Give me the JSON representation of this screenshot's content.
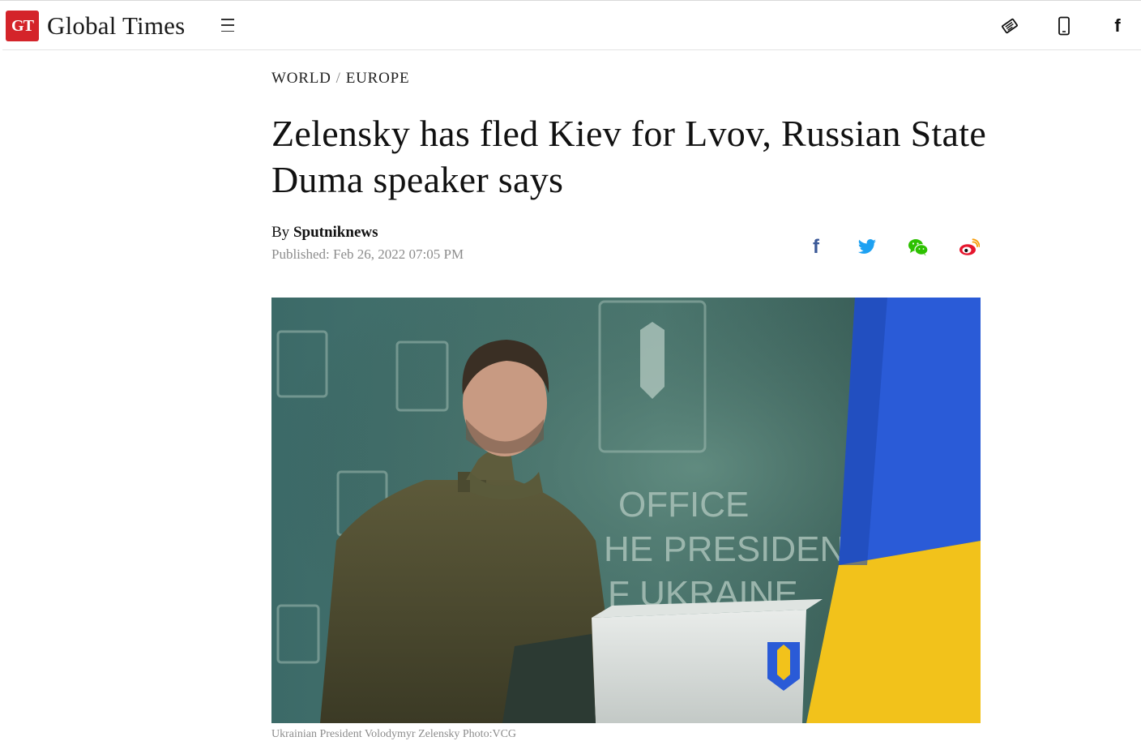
{
  "site": {
    "logo_badge": "GT",
    "name": "Global Times"
  },
  "header_icons": [
    "newspaper-icon",
    "mobile-phone-icon",
    "facebook-icon"
  ],
  "header_fb_glyph": "f",
  "breadcrumb": {
    "section": "WORLD",
    "separator": "/",
    "subsection": "EUROPE"
  },
  "article": {
    "headline": "Zelensky has fled Kiev for Lvov, Russian State Duma speaker says",
    "by_prefix": "By",
    "author": "Sputniknews",
    "published": "Published: Feb 26, 2022 07:05 PM",
    "photo_caption": "Ukrainian President Volodymyr Zelensky Photo:VCG",
    "photo_text": {
      "line1": "OFFICE",
      "line2": "HE PRESIDENT",
      "line3": "F UKRAINE"
    }
  },
  "share_buttons": {
    "facebook_glyph": "f",
    "icons": [
      "facebook-share-icon",
      "twitter-share-icon",
      "wechat-share-icon",
      "weibo-share-icon"
    ]
  },
  "colors": {
    "brand_red": "#d4242a",
    "facebook_blue": "#3b5998",
    "twitter_blue": "#1da1f2",
    "wechat_green": "#2dc100",
    "weibo_red": "#e6162d",
    "flag_blue": "#2a5bd7",
    "flag_yellow": "#f2c21b"
  }
}
